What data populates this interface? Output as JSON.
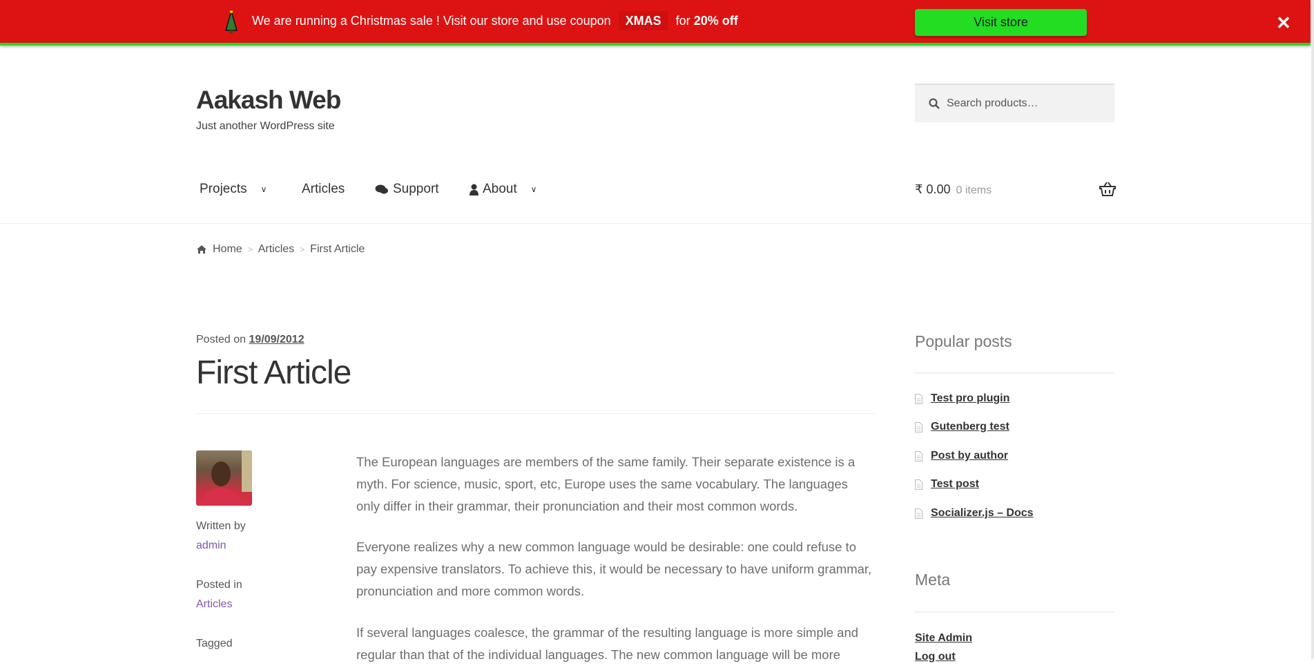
{
  "banner": {
    "text_before": "We are running a Christmas sale ! Visit our store and use coupon",
    "coupon": "XMAS",
    "text_after": "for",
    "discount": "20% off",
    "button": "Visit store",
    "close": "✕",
    "colors": {
      "background": "#dd1313",
      "accent": "#22dd22"
    }
  },
  "site": {
    "title": "Aakash Web",
    "tagline": "Just another WordPress site"
  },
  "search": {
    "placeholder": "Search products…"
  },
  "nav": [
    {
      "label": "Projects"
    },
    {
      "label": "Articles"
    },
    {
      "label": "Support"
    },
    {
      "label": "About"
    }
  ],
  "cart": {
    "amount": "₹ 0.00",
    "items": "0 items"
  },
  "breadcrumb": [
    "Home",
    "Articles",
    "First Article"
  ],
  "post": {
    "posted_on": "Posted on",
    "date": "19/09/2012",
    "title": "First Article",
    "written_by": "Written by",
    "author": "admin",
    "posted_in": "Posted in",
    "category": "Articles",
    "tagged": "Tagged",
    "paragraphs": [
      "The European languages are members of the same family. Their separate existence is a myth. For science, music, sport, etc, Europe uses the same vocabulary. The languages only differ in their grammar, their pronunciation and their most common words.",
      "Everyone realizes why a new common language would be desirable: one could refuse to pay expensive translators. To achieve this, it would be necessary to have uniform grammar, pronunciation and more common words.",
      "If several languages coalesce, the grammar of the resulting language is more simple and regular than that of the individual languages. The new common language will be more"
    ]
  },
  "sidebar": {
    "popular_title": "Popular posts",
    "popular": [
      "Test pro plugin",
      "Gutenberg test",
      "Post by author",
      "Test post",
      "Socializer.js – Docs"
    ],
    "meta_title": "Meta",
    "meta": [
      "Site Admin",
      "Log out"
    ]
  }
}
